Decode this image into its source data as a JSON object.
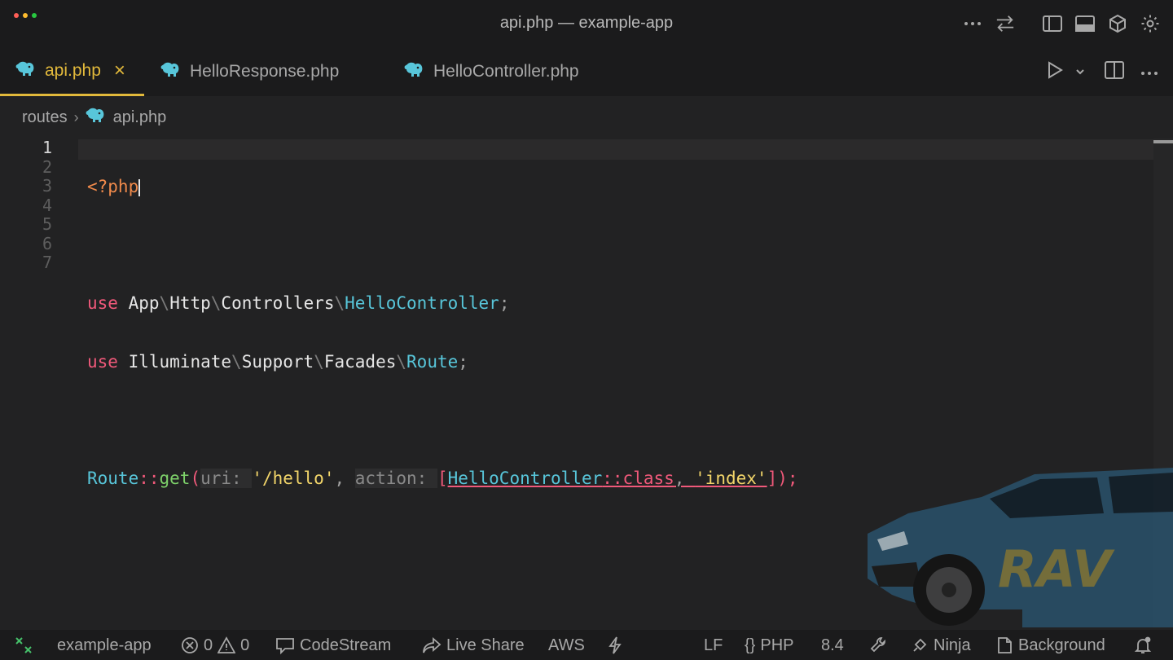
{
  "window": {
    "title": "api.php — example-app",
    "traffic_colors": [
      "#ff5f57",
      "#febc2e",
      "#28c840"
    ]
  },
  "tabs": [
    {
      "label": "api.php",
      "active": true,
      "close": "×"
    },
    {
      "label": "HelloResponse.php",
      "active": false
    },
    {
      "label": "HelloController.php",
      "active": false
    }
  ],
  "breadcrumb": {
    "folder": "routes",
    "file": "api.php"
  },
  "editor": {
    "line_numbers": [
      "1",
      "2",
      "3",
      "4",
      "5",
      "6",
      "7"
    ],
    "current_line": 1,
    "line1": {
      "open_tag": "<?php"
    },
    "line3": {
      "kw": "use",
      "p1": "App",
      "p2": "Http",
      "p3": "Controllers",
      "cls": "HelloController",
      "end": ";"
    },
    "line4": {
      "kw": "use",
      "p1": "Illuminate",
      "p2": "Support",
      "p3": "Facades",
      "cls": "Route",
      "end": ";"
    },
    "line6": {
      "cls": "Route",
      "op": "::",
      "fn": "get",
      "open": "(",
      "hint_uri": "uri: ",
      "str_uri": "'/hello'",
      "comma": ", ",
      "hint_action": "action: ",
      "bracket_open": "[",
      "cls2": "HelloController",
      "op2": "::",
      "kw_class": "class",
      "comma2": ", ",
      "str_index": "'index'",
      "bracket_close": "]",
      "close": ");"
    }
  },
  "status": {
    "remote_icon": "remote-icon",
    "project": "example-app",
    "errors": "0",
    "warnings": "0",
    "codestream": "CodeStream",
    "liveshare": "Live Share",
    "aws": "AWS",
    "line_ending": "LF",
    "language": "PHP",
    "version": "8.4",
    "ninja": "Ninja",
    "background": "Background"
  },
  "colors": {
    "accent": "#e2b93b",
    "keyword": "#f0597a",
    "class": "#58c6da",
    "function": "#7ed26a",
    "string": "#f3d66a",
    "php_tag": "#f08a4b",
    "php_icon": "#58c6da"
  }
}
